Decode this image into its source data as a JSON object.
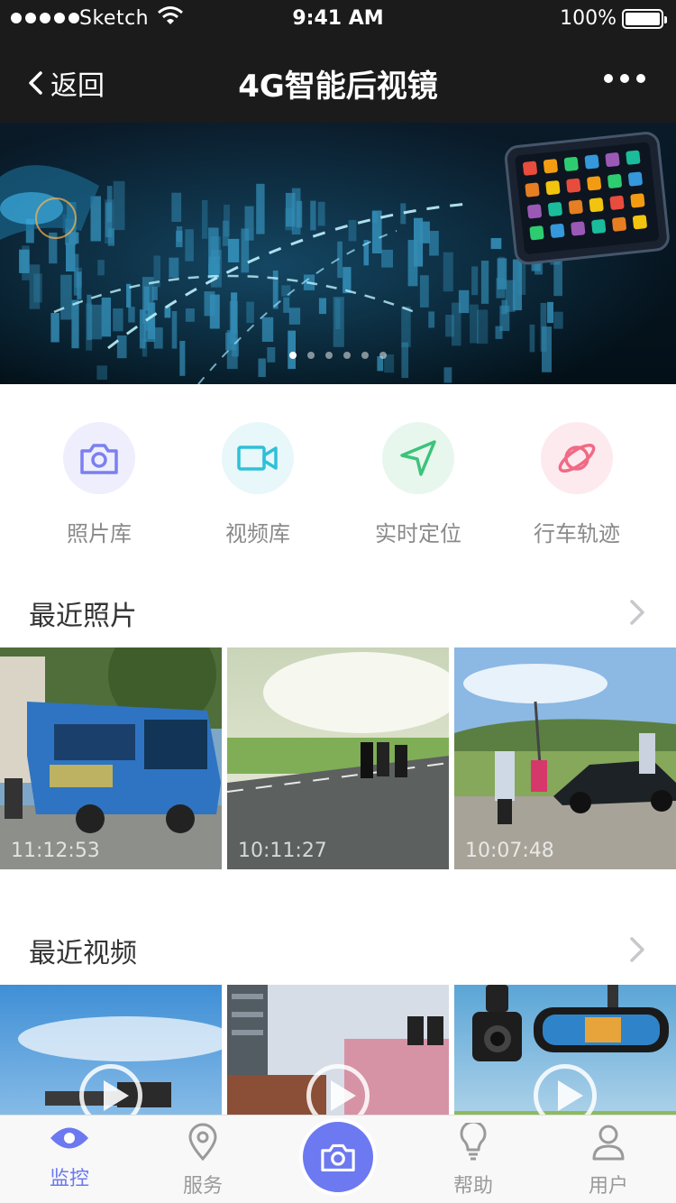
{
  "status_bar": {
    "carrier": "Sketch",
    "time": "9:41 AM",
    "battery": "100%"
  },
  "nav": {
    "back_label": "返回",
    "title": "4G智能后视镜"
  },
  "banner": {
    "slides": 6,
    "active_slide": 1
  },
  "quick_actions": [
    {
      "label": "照片库",
      "icon": "camera-icon",
      "bg": "#efeefd",
      "color": "#7a80f0"
    },
    {
      "label": "视频库",
      "icon": "video-camera-icon",
      "bg": "#e7f7fa",
      "color": "#2ec0d8"
    },
    {
      "label": "实时定位",
      "icon": "navigation-arrow-icon",
      "bg": "#e8f7ee",
      "color": "#3cc47a"
    },
    {
      "label": "行车轨迹",
      "icon": "planet-icon",
      "bg": "#fdeaee",
      "color": "#f06a86"
    }
  ],
  "recent_photos": {
    "title": "最近照片",
    "items": [
      {
        "time": "11:12:53",
        "scene": "bus"
      },
      {
        "time": "10:11:27",
        "scene": "motorcycles-road"
      },
      {
        "time": "10:07:48",
        "scene": "roadside-accident"
      }
    ]
  },
  "recent_videos": {
    "title": "最近视频",
    "items": [
      {
        "scene": "highway-sky"
      },
      {
        "scene": "city-intersection"
      },
      {
        "scene": "dashcam-products"
      }
    ]
  },
  "tabbar": {
    "tabs": [
      {
        "label": "监控",
        "icon": "eye-icon",
        "active": true
      },
      {
        "label": "服务",
        "icon": "location-pin-icon",
        "active": false
      },
      {
        "label": "帮助",
        "icon": "lightbulb-icon",
        "active": false
      },
      {
        "label": "用户",
        "icon": "user-icon",
        "active": false
      }
    ],
    "center_icon": "camera-icon",
    "accent": "#6c79f0"
  }
}
